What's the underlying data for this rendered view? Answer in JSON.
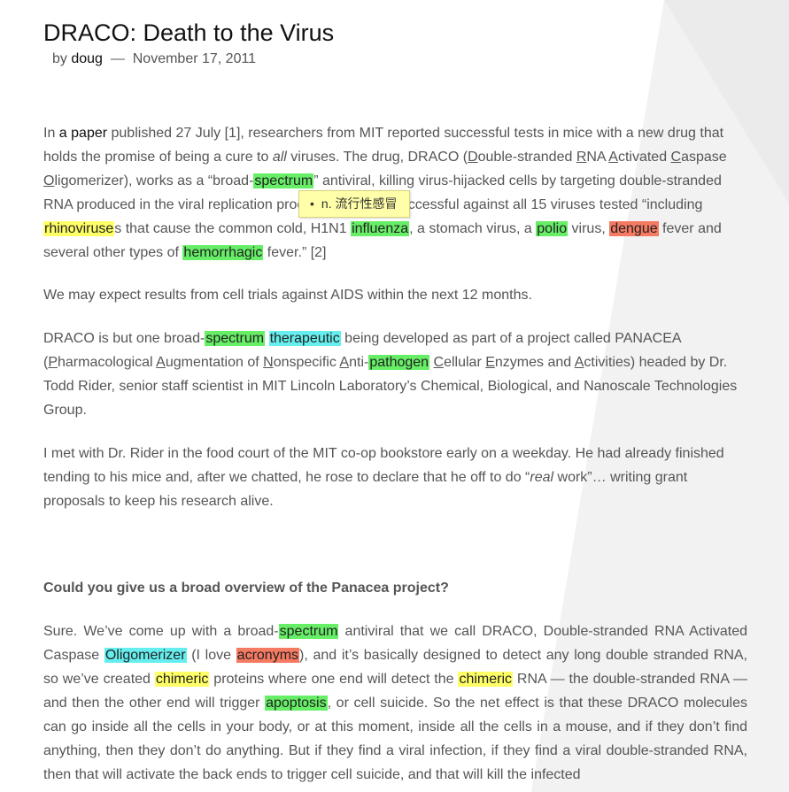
{
  "post": {
    "title": "DRACO: Death to the Virus",
    "by": "by",
    "author": "doug",
    "sep": "—",
    "date": "November 17, 2011"
  },
  "tooltip": {
    "bullet": "•",
    "text": "n. 流行性感冒"
  },
  "p1": {
    "t1": "In ",
    "link": "a paper",
    "t2": " published 27 July [1], researchers from MIT reported successful tests in mice with a new drug that holds the promise of being a cure to ",
    "all": "all",
    "t3": " viruses. The drug, DRACO (",
    "u_d": "D",
    "t4": "ouble-stranded ",
    "u_r": "R",
    "t5": "NA ",
    "u_a": "A",
    "t6": "ctivated ",
    "u_c": "C",
    "t7": "aspase ",
    "u_o": "O",
    "t8": "ligomerizer), works as a “broad-",
    "hl1": "spectrum",
    "t9": "” antiviral, killing virus-hijacked cells by targeting double-stranded RNA produced in the viral replication process. It proved successful against all 15 viruses tested “including ",
    "hl2": "rhinoviruse",
    "t10": "s that cause the common cold, H1N1 ",
    "hl3": "influenza",
    "t11": ", a stomach virus, a ",
    "hl4": "polio",
    "t12": " virus, ",
    "hl5": "dengue",
    "t13": " fever and several other types of ",
    "hl6": "hemorrhagic",
    "t14": " fever.” [2]"
  },
  "p2": "We may expect results from cell trials against AIDS within the next 12 months.",
  "p3": {
    "t1": "DRACO is but one broad-",
    "hl1": "spectrum",
    "sp": " ",
    "hl2": "therapeutic",
    "t2": " being developed as part of a project called PANACEA (",
    "u_p": "P",
    "t3": "harmacological ",
    "u_a": "A",
    "t4": "ugmentation of ",
    "u_n": "N",
    "t5": "onspecific ",
    "u_a2": "A",
    "t6": "nti-",
    "hl3": "pathogen",
    "sp2": " ",
    "u_c": "C",
    "t7": "ellular ",
    "u_e": "E",
    "t8": "nzymes and ",
    "u_a3": "A",
    "t9": "ctivities) headed by Dr. Todd Rider, senior staff scientist in MIT Lincoln Laboratory’s Chemical, Biological, and Nanoscale Technologies Group."
  },
  "p4": {
    "t1": "I met with Dr. Rider in the food court of the MIT co-op bookstore early on a weekday. He had already finished tending to his mice and, after we chatted, he rose to declare that he off to do “",
    "real": "real",
    "t2": " work”… writing grant proposals to keep his research alive."
  },
  "q1": "Could you give us a broad overview of the Panacea project?",
  "p5": {
    "t1": "Sure. We’ve come up with a broad-",
    "hl1": "spectrum",
    "t2": " antiviral that we call DRACO, Double-stranded RNA Activated Caspase ",
    "hl2": "Oligomerizer",
    "t3": " (I love ",
    "hl3": "acronyms",
    "t4": "), and it’s basically designed to detect any long double stranded RNA, so we’ve created ",
    "hl4": "chimeric",
    "t5": " proteins where one end will detect the ",
    "hl5": "chimeric",
    "t6": " RNA — the double-stranded RNA — and then the other end will trigger ",
    "hl6": "apoptosis",
    "t7": ", or cell suicide. So the net effect is that these DRACO molecules can go inside all the cells in your body, or at this moment, inside all the cells in a mouse, and if they don’t find anything, then they don’t do anything. But if they find a viral infection, if they find a viral double-stranded RNA, then that will activate the back ends to trigger cell suicide, and that will kill the infected"
  },
  "colors": {
    "highlight_green": "#66ee66",
    "highlight_yellow": "#ffff66",
    "highlight_red": "#f57a62",
    "highlight_cyan": "#66eeee",
    "tooltip_bg": "#ffffaa"
  }
}
